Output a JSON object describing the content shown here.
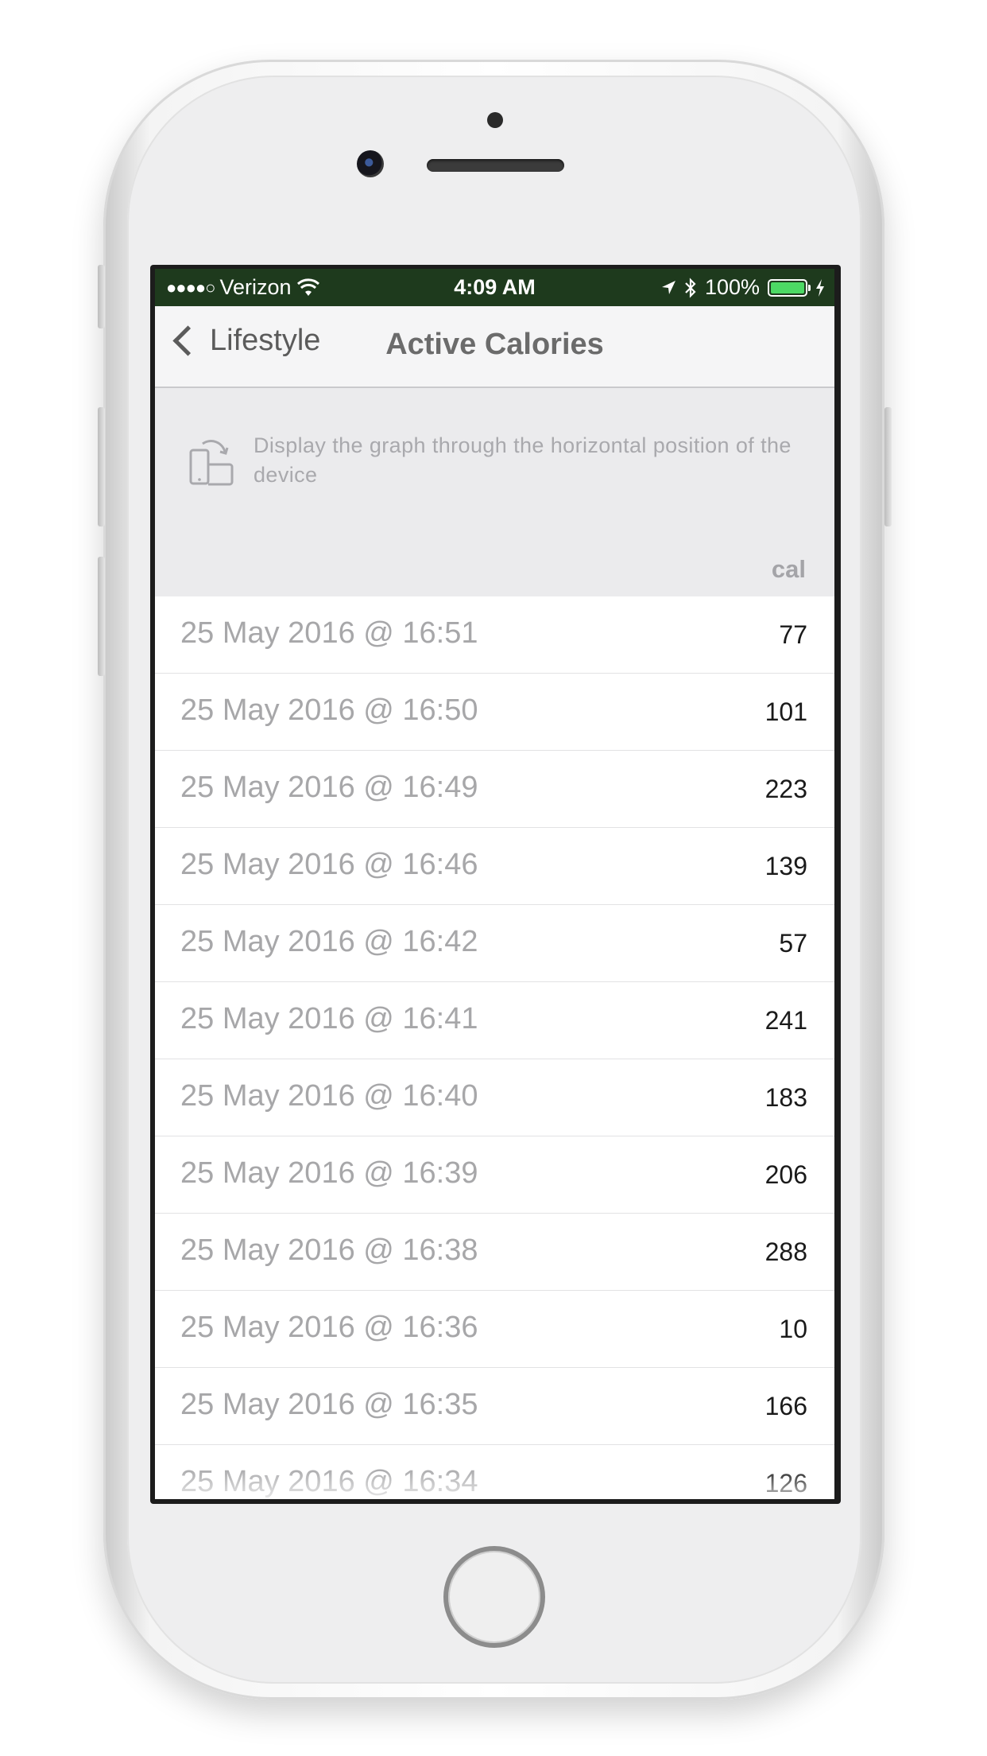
{
  "status_bar": {
    "signal": "●●●●○",
    "carrier": "Verizon",
    "time": "4:09 AM",
    "battery": "100%",
    "battery_level": 1.0
  },
  "nav": {
    "back_label": "Lifestyle",
    "title": "Active Calories"
  },
  "hint": {
    "text": "Display the graph through the horizontal position of the device",
    "icon": "rotate-device-icon"
  },
  "table": {
    "unit": "cal",
    "rows": [
      {
        "date": "25 May 2016 @ 16:51",
        "value": "77"
      },
      {
        "date": "25 May 2016 @ 16:50",
        "value": "101"
      },
      {
        "date": "25 May 2016 @ 16:49",
        "value": "223"
      },
      {
        "date": "25 May 2016 @ 16:46",
        "value": "139"
      },
      {
        "date": "25 May 2016 @ 16:42",
        "value": "57"
      },
      {
        "date": "25 May 2016 @ 16:41",
        "value": "241"
      },
      {
        "date": "25 May 2016 @ 16:40",
        "value": "183"
      },
      {
        "date": "25 May 2016 @ 16:39",
        "value": "206"
      },
      {
        "date": "25 May 2016 @ 16:38",
        "value": "288"
      },
      {
        "date": "25 May 2016 @ 16:36",
        "value": "10"
      },
      {
        "date": "25 May 2016 @ 16:35",
        "value": "166"
      },
      {
        "date": "25 May 2016 @ 16:34",
        "value": "126"
      }
    ]
  },
  "colors": {
    "status_bar_bg": "#1e3a1d",
    "battery_green": "#4cd964",
    "nav_bg": "#f5f5f6",
    "section_bg": "#ebebed"
  }
}
